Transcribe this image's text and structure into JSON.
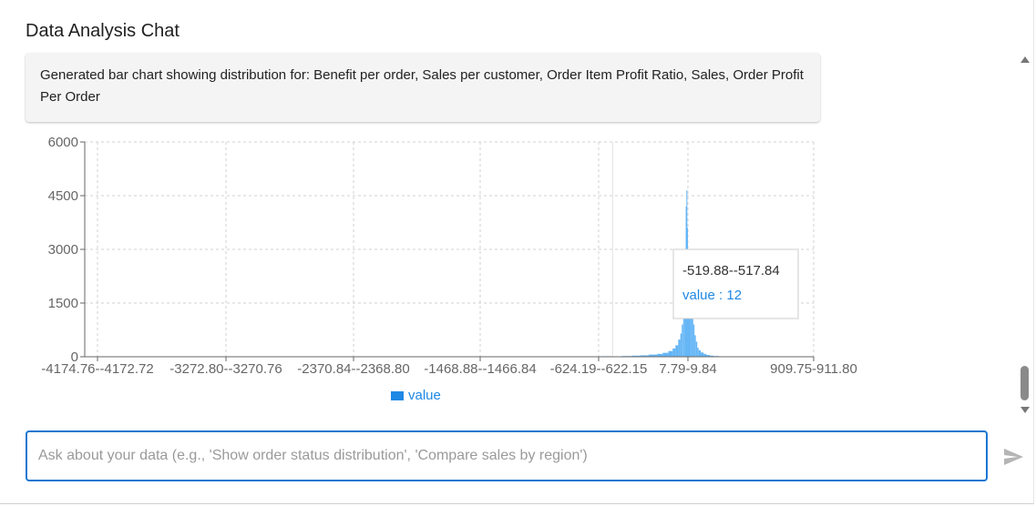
{
  "app": {
    "title": "Data Analysis Chat"
  },
  "message": {
    "text": "Generated bar chart showing distribution for: Benefit per order, Sales per customer, Order Item Profit Ratio, Sales, Order Profit Per Order"
  },
  "chart_data": {
    "type": "bar",
    "title": "",
    "xlabel": "",
    "ylabel": "",
    "yticks": [
      "0",
      "1500",
      "3000",
      "4500",
      "6000"
    ],
    "ylim": [
      0,
      6000
    ],
    "xtick_labels": [
      "-4174.76--4172.72",
      "-3272.80--3270.76",
      "-2370.84--2368.80",
      "-1468.88--1466.84",
      "-624.19--622.15",
      "7.79-9.84",
      "909.75-911.80"
    ],
    "grid": true,
    "legend": {
      "position": "bottom-center",
      "items": [
        "value"
      ]
    },
    "series": [
      {
        "name": "value",
        "color": "#64b5f6",
        "bins": [
          {
            "x": -700,
            "y": 10
          },
          {
            "x": -600,
            "y": 15
          },
          {
            "x": -520,
            "y": 12
          },
          {
            "x": -450,
            "y": 20
          },
          {
            "x": -380,
            "y": 30
          },
          {
            "x": -320,
            "y": 40
          },
          {
            "x": -260,
            "y": 60
          },
          {
            "x": -200,
            "y": 80
          },
          {
            "x": -160,
            "y": 110
          },
          {
            "x": -120,
            "y": 160
          },
          {
            "x": -90,
            "y": 230
          },
          {
            "x": -70,
            "y": 320
          },
          {
            "x": -50,
            "y": 480
          },
          {
            "x": -35,
            "y": 650
          },
          {
            "x": -25,
            "y": 900
          },
          {
            "x": -15,
            "y": 1300
          },
          {
            "x": -8,
            "y": 2000
          },
          {
            "x": -2,
            "y": 3000
          },
          {
            "x": 3,
            "y": 4200
          },
          {
            "x": 8,
            "y": 4650
          },
          {
            "x": 12,
            "y": 3600
          },
          {
            "x": 18,
            "y": 2700
          },
          {
            "x": 25,
            "y": 2000
          },
          {
            "x": 32,
            "y": 1800
          },
          {
            "x": 40,
            "y": 1500
          },
          {
            "x": 48,
            "y": 1200
          },
          {
            "x": 56,
            "y": 900
          },
          {
            "x": 65,
            "y": 600
          },
          {
            "x": 75,
            "y": 420
          },
          {
            "x": 85,
            "y": 250
          },
          {
            "x": 95,
            "y": 180
          },
          {
            "x": 110,
            "y": 120
          },
          {
            "x": 130,
            "y": 80
          },
          {
            "x": 150,
            "y": 50
          },
          {
            "x": 175,
            "y": 30
          },
          {
            "x": 200,
            "y": 20
          },
          {
            "x": 240,
            "y": 10
          },
          {
            "x": 280,
            "y": 5
          }
        ]
      }
    ],
    "tooltip": {
      "label": "-519.88--517.84",
      "series": "value",
      "value": 12
    }
  },
  "tooltip_view": {
    "label": "-519.88--517.84",
    "value_text": "value : 12"
  },
  "input": {
    "placeholder": "Ask about your data (e.g., 'Show order status distribution', 'Compare sales by region')",
    "value": ""
  },
  "icons": {
    "send": "send-icon",
    "scroll_up": "arrow-up-icon",
    "scroll_down": "arrow-down-icon"
  },
  "colors": {
    "accent": "#1976d2",
    "bar": "#64b5f6",
    "tooltip_value": "#1e88e5"
  }
}
